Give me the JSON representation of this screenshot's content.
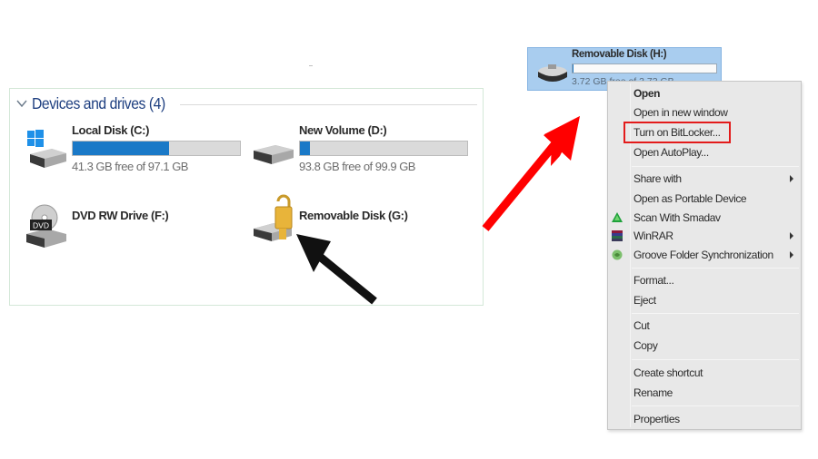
{
  "explorer": {
    "group_title": "Devices and drives (4)",
    "drives": [
      {
        "name": "Local Disk (C:)",
        "free_text": "41.3 GB free of 97.1 GB",
        "used_fraction": 0.575,
        "icon": "windows-drive-icon"
      },
      {
        "name": "New Volume (D:)",
        "free_text": "93.8 GB free of 99.9 GB",
        "used_fraction": 0.061,
        "icon": "hard-drive-icon"
      },
      {
        "name": "DVD RW Drive (F:)",
        "icon": "dvd-drive-icon",
        "icon_text": "DVD"
      },
      {
        "name": "Removable Disk (G:)",
        "icon": "locked-drive-icon"
      }
    ]
  },
  "selected_drive": {
    "name": "Removable Disk (H:)",
    "free_text": "3.72 GB free of 3.73 GB",
    "used_fraction": 0.003
  },
  "context_menu": {
    "items": [
      {
        "label": "Open",
        "bold": true
      },
      {
        "label": "Open in new window"
      },
      {
        "label": "Turn on BitLocker...",
        "highlighted": true
      },
      {
        "label": "Open AutoPlay..."
      },
      {
        "label": "Share with",
        "submenu": true
      },
      {
        "label": "Open as Portable Device"
      },
      {
        "label": "Scan With Smadav",
        "icon": "smadav-icon"
      },
      {
        "label": "WinRAR",
        "icon": "winrar-icon",
        "submenu": true
      },
      {
        "label": "Groove Folder Synchronization",
        "icon": "groove-icon",
        "submenu": true
      },
      {
        "label": "Format..."
      },
      {
        "label": "Eject"
      },
      {
        "label": "Cut"
      },
      {
        "label": "Copy"
      },
      {
        "label": "Create shortcut"
      },
      {
        "label": "Rename"
      },
      {
        "label": "Properties"
      }
    ]
  },
  "annotations": {
    "highlight_color": "#e31b1b",
    "red_arrow_color": "#ff0000",
    "black_arrow_color": "#111111"
  },
  "colors": {
    "group_title": "#1e3f80",
    "progress_fill": "#1a79c7",
    "tile_selected": "#a9cdef"
  }
}
